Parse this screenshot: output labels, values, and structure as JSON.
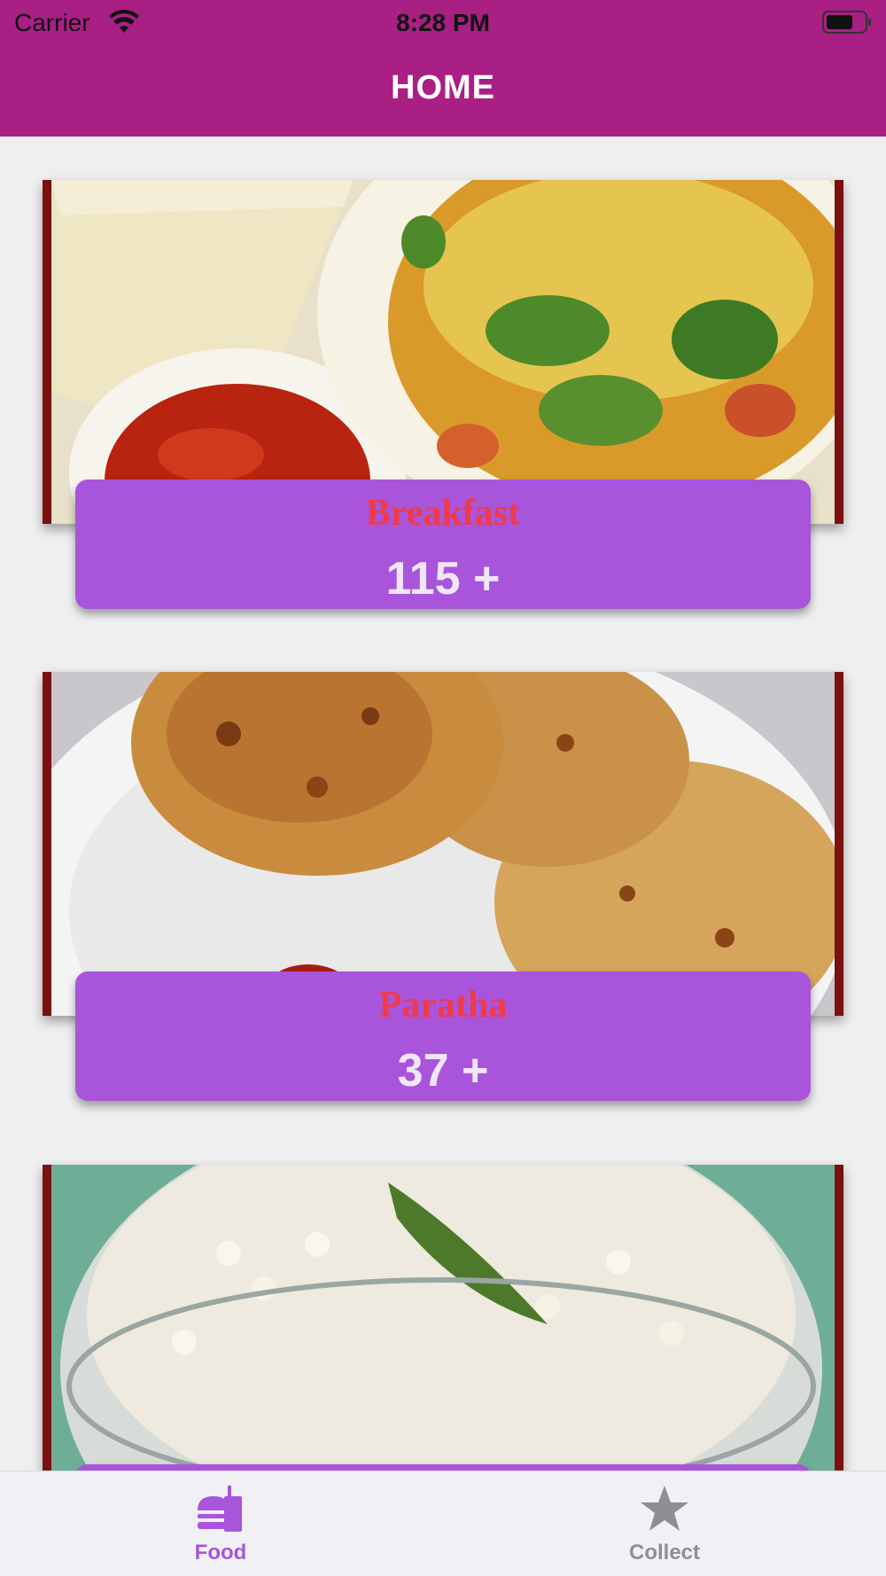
{
  "status_bar": {
    "carrier": "Carrier",
    "time": "8:28 PM"
  },
  "nav": {
    "title": "HOME"
  },
  "colors": {
    "header": "#a91f84",
    "card_label_bg": "#a855dc",
    "card_name": "#f03a4a",
    "card_count": "#f1e6f8",
    "tab_active": "#a855dc",
    "tab_inactive": "#8e8e93"
  },
  "categories": [
    {
      "name": "Breakfast",
      "count": "115 +"
    },
    {
      "name": "Paratha",
      "count": "37 +"
    },
    {
      "name": "",
      "count": ""
    }
  ],
  "tabbar": {
    "items": [
      {
        "label": "Food",
        "icon": "burger-drink-icon",
        "active": true
      },
      {
        "label": "Collect",
        "icon": "star-icon",
        "active": false
      }
    ]
  }
}
